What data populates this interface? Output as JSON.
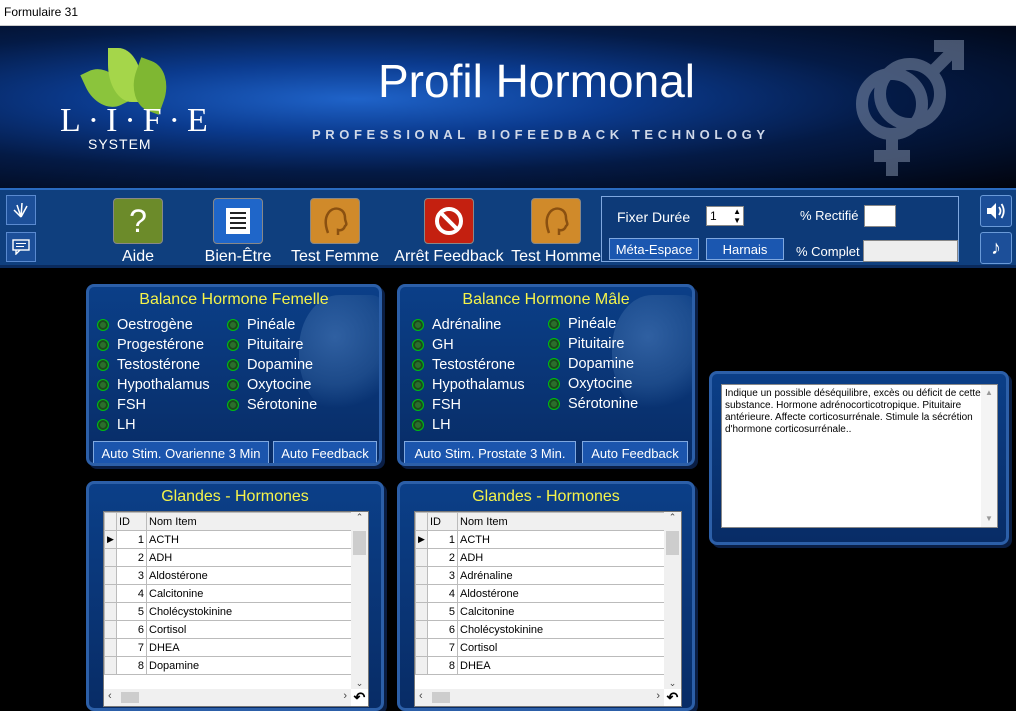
{
  "window": {
    "title": "Formulaire 31"
  },
  "header": {
    "logo_text": "L·I·F·E",
    "logo_sub": "SYSTEM",
    "title": "Profil Hormonal",
    "subtitle": "PROFESSIONAL BIOFEEDBACK TECHNOLOGY"
  },
  "toolbar": {
    "tools": [
      {
        "label": "Aide",
        "icon": "question-icon",
        "color": "#6c8b2a"
      },
      {
        "label": "Bien-Être",
        "icon": "document-icon",
        "color": "#1f66c9"
      },
      {
        "label": "Test Femme",
        "icon": "head-icon",
        "color": "#d08a2a"
      },
      {
        "label": "Arrêt Feedback",
        "icon": "stop-icon",
        "color": "#c42010"
      },
      {
        "label": "Test Homme",
        "icon": "head-icon",
        "color": "#d08a2a"
      }
    ],
    "duration_label": "Fixer Durée",
    "duration_value": "1",
    "meta_label": "Méta-Espace",
    "harnais_label": "Harnais",
    "rectifie_label": "% Rectifié",
    "complet_label": "% Complet"
  },
  "female": {
    "title": "Balance Hormone Femelle",
    "col1": [
      "Oestrogène",
      "Progestérone",
      "Testostérone",
      "Hypothalamus",
      "FSH",
      "LH"
    ],
    "col2": [
      "Pinéale",
      "Pituitaire",
      "Dopamine",
      "Oxytocine",
      "Sérotonine"
    ],
    "auto_stim": "Auto Stim. Ovarienne 3 Min",
    "auto_feedback": "Auto Feedback"
  },
  "male": {
    "title": "Balance Hormone Mâle",
    "col1": [
      "Adrénaline",
      "GH",
      "Testostérone",
      "Hypothalamus",
      "FSH",
      "LH"
    ],
    "col2": [
      "Pinéale",
      "Pituitaire",
      "Dopamine",
      "Oxytocine",
      "Sérotonine"
    ],
    "auto_stim": "Auto Stim. Prostate 3 Min.",
    "auto_feedback": "Auto Feedback"
  },
  "glands_left": {
    "title": "Glandes - Hormones",
    "headers": [
      "ID",
      "Nom Item"
    ],
    "rows": [
      [
        "1",
        "ACTH"
      ],
      [
        "2",
        "ADH"
      ],
      [
        "3",
        "Aldostérone"
      ],
      [
        "4",
        "Calcitonine"
      ],
      [
        "5",
        "Cholécystokinine"
      ],
      [
        "6",
        "Cortisol"
      ],
      [
        "7",
        "DHEA"
      ],
      [
        "8",
        "Dopamine"
      ]
    ]
  },
  "glands_right": {
    "title": "Glandes - Hormones",
    "headers": [
      "ID",
      "Nom Item"
    ],
    "rows": [
      [
        "1",
        "ACTH"
      ],
      [
        "2",
        "ADH"
      ],
      [
        "3",
        "Adrénaline"
      ],
      [
        "4",
        "Aldostérone"
      ],
      [
        "5",
        "Calcitonine"
      ],
      [
        "6",
        "Cholécystokinine"
      ],
      [
        "7",
        "Cortisol"
      ],
      [
        "8",
        "DHEA"
      ]
    ]
  },
  "description": "Indique un possible déséquilibre, excès ou déficit de cette substance.  Hormone adrénocorticotropique. Pituitaire antérieure.  Affecte corticosurrénale.  Stimule la sécrétion d'hormone corticosurrénale.."
}
